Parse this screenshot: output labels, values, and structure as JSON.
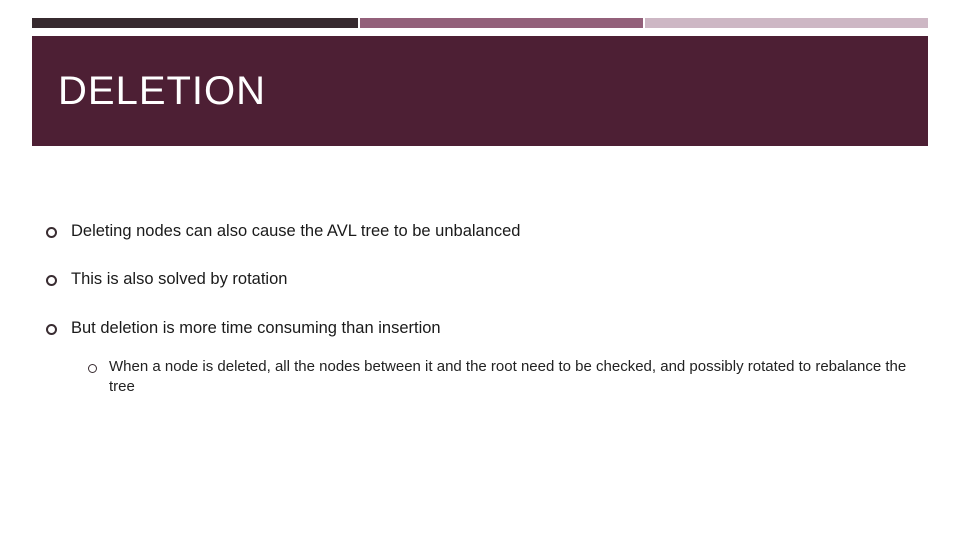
{
  "title": "DELETION",
  "accent_colors": {
    "seg1": "#372a2f",
    "seg2": "#93607a",
    "seg3": "#cdb7c4"
  },
  "title_bg": "#4d1f34",
  "bullets": [
    {
      "text": "Deleting nodes can also cause the AVL tree to be unbalanced"
    },
    {
      "text": "This is also solved by rotation"
    },
    {
      "text": "But deletion is more time consuming than insertion",
      "children": [
        {
          "text": "When a node is deleted, all the nodes between it and the root need to be checked, and possibly rotated to rebalance the tree"
        }
      ]
    }
  ]
}
